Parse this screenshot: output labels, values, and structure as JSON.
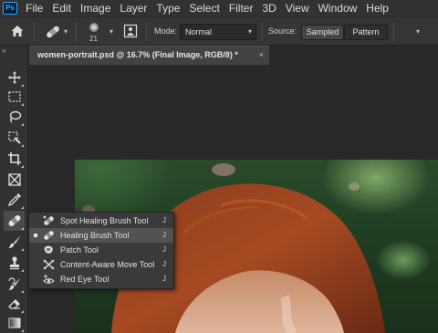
{
  "app": {
    "logo_text": "Ps"
  },
  "menu": [
    "File",
    "Edit",
    "Image",
    "Layer",
    "Type",
    "Select",
    "Filter",
    "3D",
    "View",
    "Window",
    "Help"
  ],
  "options": {
    "brush_size": "21",
    "mode_label": "Mode:",
    "mode_value": "Normal",
    "source_label": "Source:",
    "source_options": [
      "Sampled",
      "Pattern"
    ],
    "source_selected": "Sampled"
  },
  "toolbar": {
    "collapse_glyph": "»",
    "tools": [
      {
        "name": "move-tool",
        "icon": "move-icon"
      },
      {
        "name": "marquee-tool",
        "icon": "marquee-icon"
      },
      {
        "name": "lasso-tool",
        "icon": "lasso-icon"
      },
      {
        "name": "quick-selection-tool",
        "icon": "quick-selection-icon"
      },
      {
        "name": "crop-tool",
        "icon": "crop-icon"
      },
      {
        "name": "frame-tool",
        "icon": "frame-icon"
      },
      {
        "name": "eyedropper-tool",
        "icon": "eyedropper-icon"
      },
      {
        "name": "healing-brush-tool",
        "icon": "bandage-icon",
        "active": true
      },
      {
        "name": "brush-tool",
        "icon": "brush-icon"
      },
      {
        "name": "clone-stamp-tool",
        "icon": "stamp-icon"
      },
      {
        "name": "history-brush-tool",
        "icon": "history-brush-icon"
      },
      {
        "name": "eraser-tool",
        "icon": "eraser-icon"
      },
      {
        "name": "gradient-tool",
        "icon": "gradient-icon"
      }
    ]
  },
  "document": {
    "tab_title": "women-portrait.psd @ 16.7% (Final Image, RGB/8) *",
    "close_glyph": "×"
  },
  "flyout": {
    "items": [
      {
        "label": "Spot Healing Brush Tool",
        "shortcut": "J",
        "icon": "spot-healing-icon",
        "selected": false
      },
      {
        "label": "Healing Brush Tool",
        "shortcut": "J",
        "icon": "healing-brush-icon",
        "selected": true
      },
      {
        "label": "Patch Tool",
        "shortcut": "J",
        "icon": "patch-icon",
        "selected": false
      },
      {
        "label": "Content-Aware Move Tool",
        "shortcut": "J",
        "icon": "content-aware-move-icon",
        "selected": false
      },
      {
        "label": "Red Eye Tool",
        "shortcut": "J",
        "icon": "red-eye-icon",
        "selected": false
      }
    ]
  }
}
